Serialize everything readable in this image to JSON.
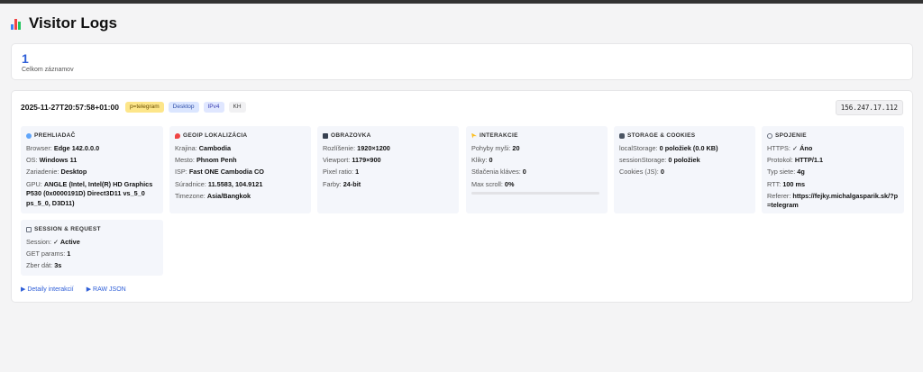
{
  "page": {
    "title": "Visitor Logs"
  },
  "summary": {
    "count": "1",
    "count_label": "Celkom záznamov"
  },
  "log": {
    "timestamp": "2025-11-27T20:57:58+01:00",
    "badges": {
      "ref": "p=telegram",
      "device": "Desktop",
      "ip_version": "IPv4",
      "country": "KH"
    },
    "ip": "156.247.17.112",
    "panels": {
      "browser": {
        "title": "PREHLIADAČ",
        "rows": [
          {
            "label": "Browser:",
            "value": "Edge 142.0.0.0"
          },
          {
            "label": "OS:",
            "value": "Windows 11"
          },
          {
            "label": "Zariadenie:",
            "value": "Desktop"
          },
          {
            "label": "GPU:",
            "value": "ANGLE (Intel, Intel(R) HD Graphics P530 (0x0000191D) Direct3D11 vs_5_0 ps_5_0, D3D11)"
          }
        ]
      },
      "geoip": {
        "title": "GEOIP LOKALIZÁCIA",
        "rows": [
          {
            "label": "Krajina:",
            "value": "Cambodia"
          },
          {
            "label": "Mesto:",
            "value": "Phnom Penh"
          },
          {
            "label": "ISP:",
            "value": "Fast ONE Cambodia CO"
          },
          {
            "label": "Súradnice:",
            "value": "11.5583, 104.9121"
          },
          {
            "label": "Timezone:",
            "value": "Asia/Bangkok"
          }
        ]
      },
      "screen": {
        "title": "OBRAZOVKA",
        "rows": [
          {
            "label": "Rozlíšenie:",
            "value": "1920×1200"
          },
          {
            "label": "Viewport:",
            "value": "1179×900"
          },
          {
            "label": "Pixel ratio:",
            "value": "1"
          },
          {
            "label": "Farby:",
            "value": "24-bit"
          }
        ]
      },
      "interaction": {
        "title": "INTERAKCIE",
        "rows": [
          {
            "label": "Pohyby myši:",
            "value": "20"
          },
          {
            "label": "Kliky:",
            "value": "0"
          },
          {
            "label": "Stlačenia kláves:",
            "value": "0"
          },
          {
            "label": "Max scroll:",
            "value": "0%"
          }
        ],
        "scroll_percent": 0
      },
      "storage": {
        "title": "STORAGE & COOKIES",
        "rows": [
          {
            "label": "localStorage:",
            "value": "0 položiek (0.0 KB)"
          },
          {
            "label": "sessionStorage:",
            "value": "0 položiek"
          },
          {
            "label": "Cookies (JS):",
            "value": "0"
          }
        ]
      },
      "connection": {
        "title": "SPOJENIE",
        "rows": [
          {
            "label": "HTTPS:",
            "value": "✓ Áno"
          },
          {
            "label": "Protokol:",
            "value": "HTTP/1.1"
          },
          {
            "label": "Typ siete:",
            "value": "4g"
          },
          {
            "label": "RTT:",
            "value": "100 ms"
          },
          {
            "label": "Referer:",
            "value": "https://fejky.michalgasparik.sk/?p=telegram"
          }
        ]
      },
      "session": {
        "title": "SESSION & REQUEST",
        "rows": [
          {
            "label": "Session:",
            "value": "✓ Active"
          },
          {
            "label": "GET params:",
            "value": "1"
          },
          {
            "label": "Zber dát:",
            "value": "3s"
          }
        ]
      }
    },
    "links": {
      "details": "▶ Detaily interakcií",
      "raw": "▶ RAW JSON"
    }
  },
  "colors": {
    "accent": "#2f5fd8",
    "ref_badge": "#fde68a",
    "device_badge": "#dbe6ff",
    "ip_badge": "#e0e7ff"
  },
  "icons": {
    "title": "bar-chart-icon",
    "browser": "globe-icon",
    "geoip": "pin-icon",
    "screen": "monitor-icon",
    "interaction": "cursor-icon",
    "storage": "database-icon",
    "connection": "link-icon",
    "session": "clipboard-icon"
  }
}
